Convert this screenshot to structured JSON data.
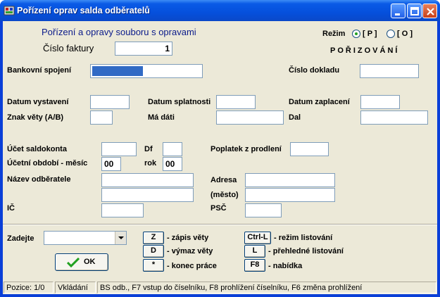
{
  "window": {
    "title": "Pořízení oprav salda odběratelů"
  },
  "header": {
    "heading": "Pořízení a opravy souboru s opravami",
    "invoice_label": "Číslo faktury",
    "invoice_value": "1",
    "mode_label": "Režim",
    "mode_p": "[ P ]",
    "mode_o": "[ O ]",
    "mode_status": "POŘIZOVÁNÍ"
  },
  "form": {
    "bank_label": "Bankovní spojení",
    "doc_no_label": "Číslo dokladu",
    "issue_date_label": "Datum vystavení",
    "due_date_label": "Datum splatnosti",
    "paid_date_label": "Datum zaplacení",
    "row_sign_label": "Znak věty (A/B)",
    "debit_label": "Má dáti",
    "credit_label": "Dal",
    "account_label": "Účet saldokonta",
    "df_label": "Df",
    "late_fee_label": "Poplatek z prodlení",
    "period_month_label": "Účetní období - měsíc",
    "period_month_value": "00",
    "year_label": "rok",
    "year_value": "00",
    "customer_label": "Název odběratele",
    "address_label": "Adresa",
    "city_label": "(město)",
    "ic_label": "IČ",
    "psc_label": "PSČ"
  },
  "footer": {
    "zadejte_label": "Zadejte",
    "ok_label": "OK",
    "keys": [
      {
        "key": "Z",
        "desc": "- zápis věty"
      },
      {
        "key": "D",
        "desc": "- výmaz věty"
      },
      {
        "key": "*",
        "desc": "- konec práce"
      },
      {
        "key": "Ctrl-L",
        "desc": "- režim listování"
      },
      {
        "key": "L",
        "desc": "- přehledné listování"
      },
      {
        "key": "F8",
        "desc": "- nabídka"
      }
    ]
  },
  "status": {
    "position": "Pozice: 1/0",
    "mode": "Vkládání",
    "hint": "BS odb., F7 vstup do číselníku, F8 prohlížení číselníku, F6 změna prohlížení"
  },
  "colors": {
    "title_bar": "#0550dc",
    "client_bg": "#ece9d8",
    "heading_text": "#0a1a8a",
    "highlight_field": "#316ac5",
    "ok_icon": "#21a121"
  }
}
